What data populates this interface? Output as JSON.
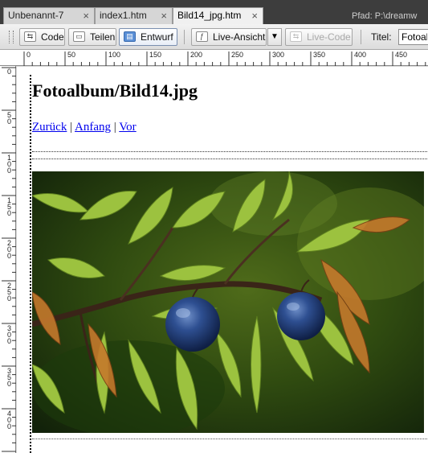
{
  "tabs": [
    {
      "label": "Unbenannt-7",
      "close": "×"
    },
    {
      "label": "index1.htm",
      "close": "×"
    },
    {
      "label": "Bild14_jpg.htm",
      "close": "×"
    }
  ],
  "path": "Pfad: P:\\dreamw",
  "toolbar": {
    "code_label": "Code",
    "split_label": "Teilen",
    "design_label": "Entwurf",
    "live_view_label": "Live-Ansicht",
    "live_code_label": "Live-Code",
    "title_label": "Titel:",
    "title_value": "Fotoal"
  },
  "ruler": {
    "h_labels": [
      "0",
      "50",
      "100",
      "150",
      "200",
      "250",
      "300",
      "350",
      "400",
      "450"
    ],
    "v_labels": [
      "0",
      "50",
      "100",
      "150",
      "200",
      "250",
      "300",
      "350",
      "400"
    ]
  },
  "page": {
    "heading": "Fotoalbum/Bild14.jpg",
    "nav_back": "Zurück",
    "nav_home": "Anfang",
    "nav_next": "Vor",
    "nav_separator": "|"
  },
  "colors": {
    "link": "#0000ee",
    "tabbar_bg": "#3d3d3d"
  }
}
